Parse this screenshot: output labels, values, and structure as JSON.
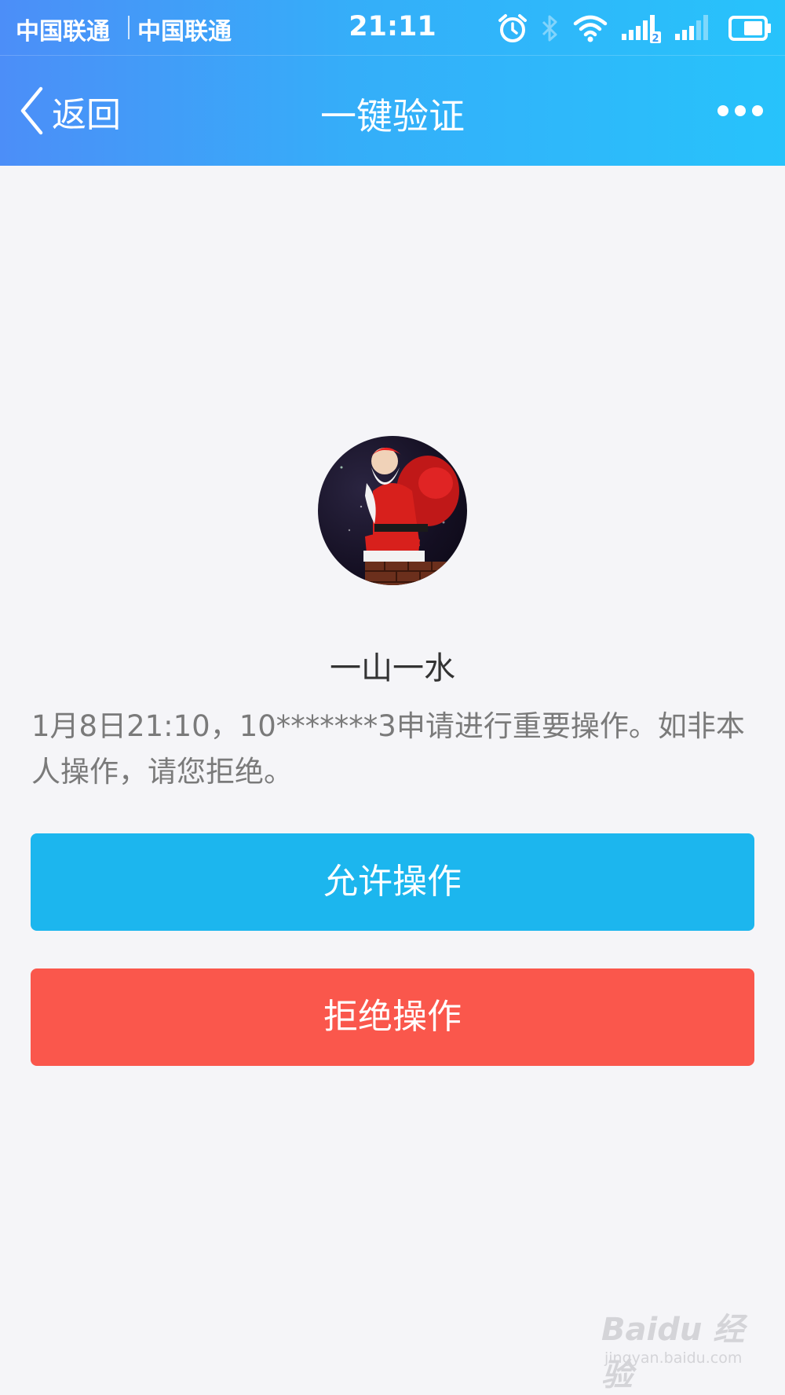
{
  "status_bar": {
    "carrier_1": "中国联通",
    "carrier_2": "中国联通",
    "time": "21:11",
    "sim2_badge": "2",
    "icons": [
      "alarm-icon",
      "bluetooth-icon",
      "wifi-icon",
      "signal-sim1-icon",
      "signal-sim2-icon",
      "battery-icon"
    ]
  },
  "nav": {
    "back_label": "返回",
    "title": "一键验证",
    "more_icon": "more-icon"
  },
  "profile": {
    "name": "一山一水"
  },
  "message": "1月8日21:10，10*******3申请进行重要操作。如非本人操作，请您拒绝。",
  "buttons": {
    "allow": "允许操作",
    "deny": "拒绝操作"
  },
  "colors": {
    "header_start": "#4c8ef8",
    "header_end": "#27c3fb",
    "allow_button": "#1cb6ee",
    "deny_button": "#fa574c",
    "background": "#f5f5f8"
  },
  "watermark": {
    "brand": "Baidu 经验",
    "url": "jingyan.baidu.com"
  }
}
